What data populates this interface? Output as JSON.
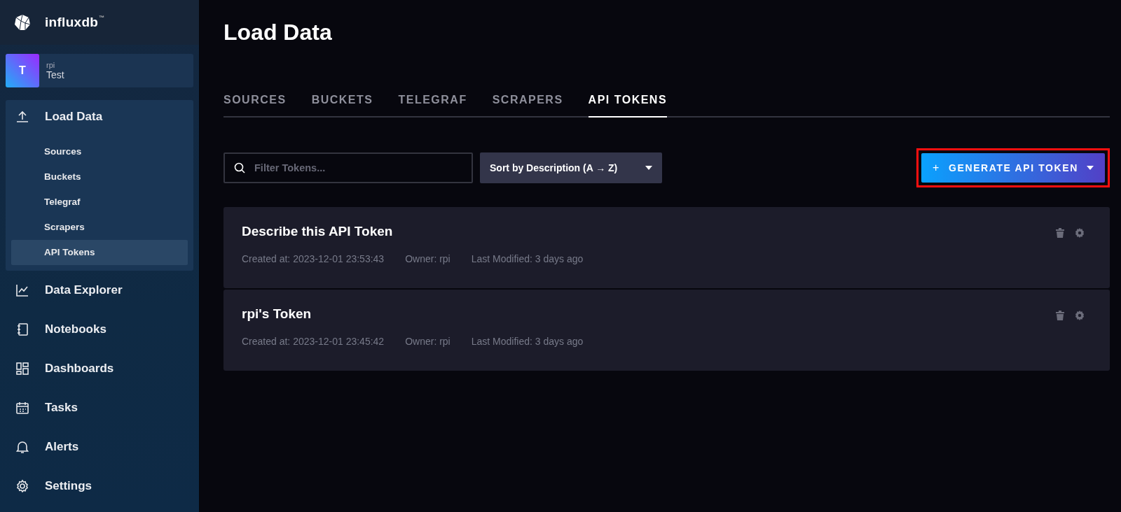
{
  "sidebar": {
    "brand": "influxdb",
    "brand_mark": "™",
    "org": {
      "avatar": "T",
      "user": "rpi",
      "name": "Test"
    },
    "items": [
      {
        "label": "Load Data",
        "kind": "upload",
        "expanded": true,
        "children": [
          {
            "label": "Sources",
            "selected": false
          },
          {
            "label": "Buckets",
            "selected": false
          },
          {
            "label": "Telegraf",
            "selected": false
          },
          {
            "label": "Scrapers",
            "selected": false
          },
          {
            "label": "API Tokens",
            "selected": true
          }
        ]
      },
      {
        "label": "Data Explorer",
        "kind": "chart",
        "expanded": false
      },
      {
        "label": "Notebooks",
        "kind": "notebook",
        "expanded": false
      },
      {
        "label": "Dashboards",
        "kind": "dashboard",
        "expanded": false
      },
      {
        "label": "Tasks",
        "kind": "calendar",
        "expanded": false
      },
      {
        "label": "Alerts",
        "kind": "bell",
        "expanded": false
      },
      {
        "label": "Settings",
        "kind": "gear",
        "expanded": false
      }
    ]
  },
  "page": {
    "title": "Load Data"
  },
  "tabs": [
    {
      "label": "SOURCES",
      "selected": false
    },
    {
      "label": "BUCKETS",
      "selected": false
    },
    {
      "label": "TELEGRAF",
      "selected": false
    },
    {
      "label": "SCRAPERS",
      "selected": false
    },
    {
      "label": "API TOKENS",
      "selected": true
    }
  ],
  "toolbar": {
    "search": {
      "placeholder": "Filter Tokens..."
    },
    "sort": "Sort by Description (A → Z)",
    "generate_button": {
      "icon": "+",
      "label": "GENERATE API TOKEN",
      "highlighted": true
    }
  },
  "tokens": [
    {
      "description": "Describe this API Token",
      "created": "Created at: 2023-12-01 23:53:43",
      "owner": "Owner: rpi",
      "modified": "Last Modified: 3 days ago"
    },
    {
      "description": "rpi's Token",
      "created": "Created at: 2023-12-01 23:45:42",
      "owner": "Owner: rpi",
      "modified": "Last Modified: 3 days ago"
    }
  ]
}
